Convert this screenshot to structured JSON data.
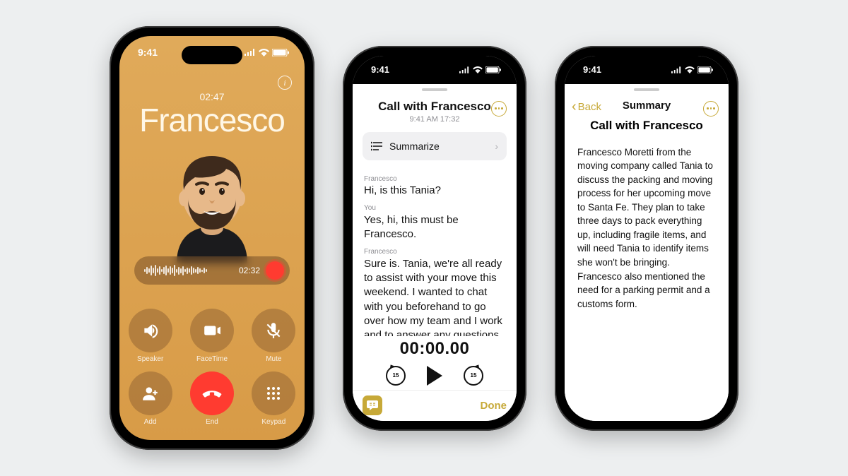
{
  "status_time": "9:41",
  "phone1": {
    "timer": "02:47",
    "name": "Francesco",
    "rec_time": "02:32",
    "buttons": {
      "speaker": "Speaker",
      "facetime": "FaceTime",
      "mute": "Mute",
      "add": "Add",
      "end": "End",
      "keypad": "Keypad"
    }
  },
  "phone2": {
    "title": "Call with Francesco",
    "subtitle": "9:41 AM  17:32",
    "summarize_label": "Summarize",
    "skip_label": "15",
    "transcript": [
      {
        "speaker": "Francesco",
        "text": "Hi, is this Tania?"
      },
      {
        "speaker": "You",
        "text": "Yes, hi, this must be Francesco."
      },
      {
        "speaker": "Francesco",
        "text": "Sure is. Tania, we're all ready to assist with your move this weekend. I wanted to chat with you beforehand to go over how my team and I work and to answer any questions you might have before we arrive Saturday"
      }
    ],
    "playback_time": "00:00.00",
    "done_label": "Done"
  },
  "phone3": {
    "back_label": "Back",
    "header": "Summary",
    "title": "Call with Francesco",
    "body": "Francesco Moretti from the moving company called Tania to discuss the packing and moving process for her upcoming move to Santa Fe. They plan to take three days to pack everything up, including fragile items, and will need Tania to identify items she won't be bringing. Francesco also mentioned the need for a parking permit and a customs form."
  }
}
